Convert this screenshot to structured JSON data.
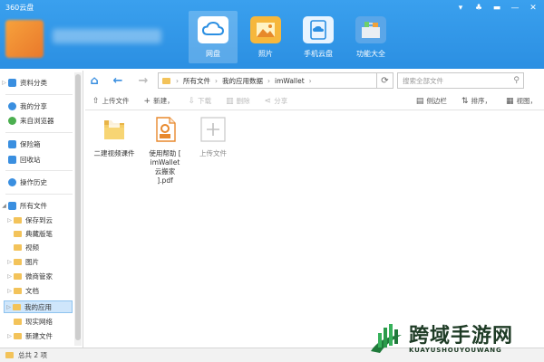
{
  "app": {
    "title": "360云盘"
  },
  "window_controls": [
    "▾",
    "♣",
    "▬",
    "—",
    "✕"
  ],
  "main_tabs": [
    {
      "label": "网盘",
      "active": true
    },
    {
      "label": "照片",
      "active": false
    },
    {
      "label": "手机云盘",
      "active": false
    },
    {
      "label": "功能大全",
      "active": false
    }
  ],
  "nav": {
    "back": "←",
    "forward": "→",
    "home": "⌂",
    "path": [
      "所有文件",
      "我的应用数据",
      "imWallet"
    ],
    "path_sep": "›",
    "refresh": "⟳",
    "search_placeholder": "搜索全部文件"
  },
  "toolbar": {
    "upload": "上传文件",
    "new": "新建，",
    "download": "下载",
    "delete": "删除",
    "share": "分享",
    "sidebar": "侧边栏",
    "sort": "排序，",
    "view": "视图，"
  },
  "sidebar": {
    "items": [
      {
        "label": "资料分类",
        "type": "cat",
        "color": "#3a8fe0"
      },
      {
        "label": "我的分享",
        "type": "cat",
        "color": "#3a8fe0"
      },
      {
        "label": "来自浏览器",
        "type": "cat",
        "color": "#4caf50"
      },
      {
        "label": "保险箱",
        "type": "cat",
        "color": "#3a8fe0"
      },
      {
        "label": "回收站",
        "type": "cat",
        "color": "#3a8fe0"
      },
      {
        "label": "操作历史",
        "type": "cat",
        "color": "#3a8fe0"
      },
      {
        "label": "所有文件",
        "type": "root"
      },
      {
        "label": "保存到云",
        "type": "folder"
      },
      {
        "label": "典藏版笔",
        "type": "folder"
      },
      {
        "label": "视频",
        "type": "folder"
      },
      {
        "label": "图片",
        "type": "folder"
      },
      {
        "label": "微商管家",
        "type": "folder"
      },
      {
        "label": "文档",
        "type": "folder"
      },
      {
        "label": "我的应用",
        "type": "folder",
        "selected": true
      },
      {
        "label": "现实网络",
        "type": "folder"
      },
      {
        "label": "新建文件",
        "type": "folder"
      }
    ]
  },
  "files": [
    {
      "name": "二建视频课件",
      "kind": "folder"
    },
    {
      "name": "使用帮助 [imWallet云搬家].pdf",
      "kind": "pdf",
      "lines": [
        "使用帮助 [",
        "imWallet",
        "云搬家",
        "].pdf"
      ]
    },
    {
      "name": "上传文件",
      "kind": "upload"
    }
  ],
  "status": {
    "text": "总共 2 项"
  },
  "watermark": {
    "cn": "跨域手游网",
    "en": "KUAYUSHOUYOUWANG"
  },
  "colors": {
    "accent": "#2b8fe2",
    "folder": "#f3c35a",
    "selected": "#cfe6fb"
  }
}
